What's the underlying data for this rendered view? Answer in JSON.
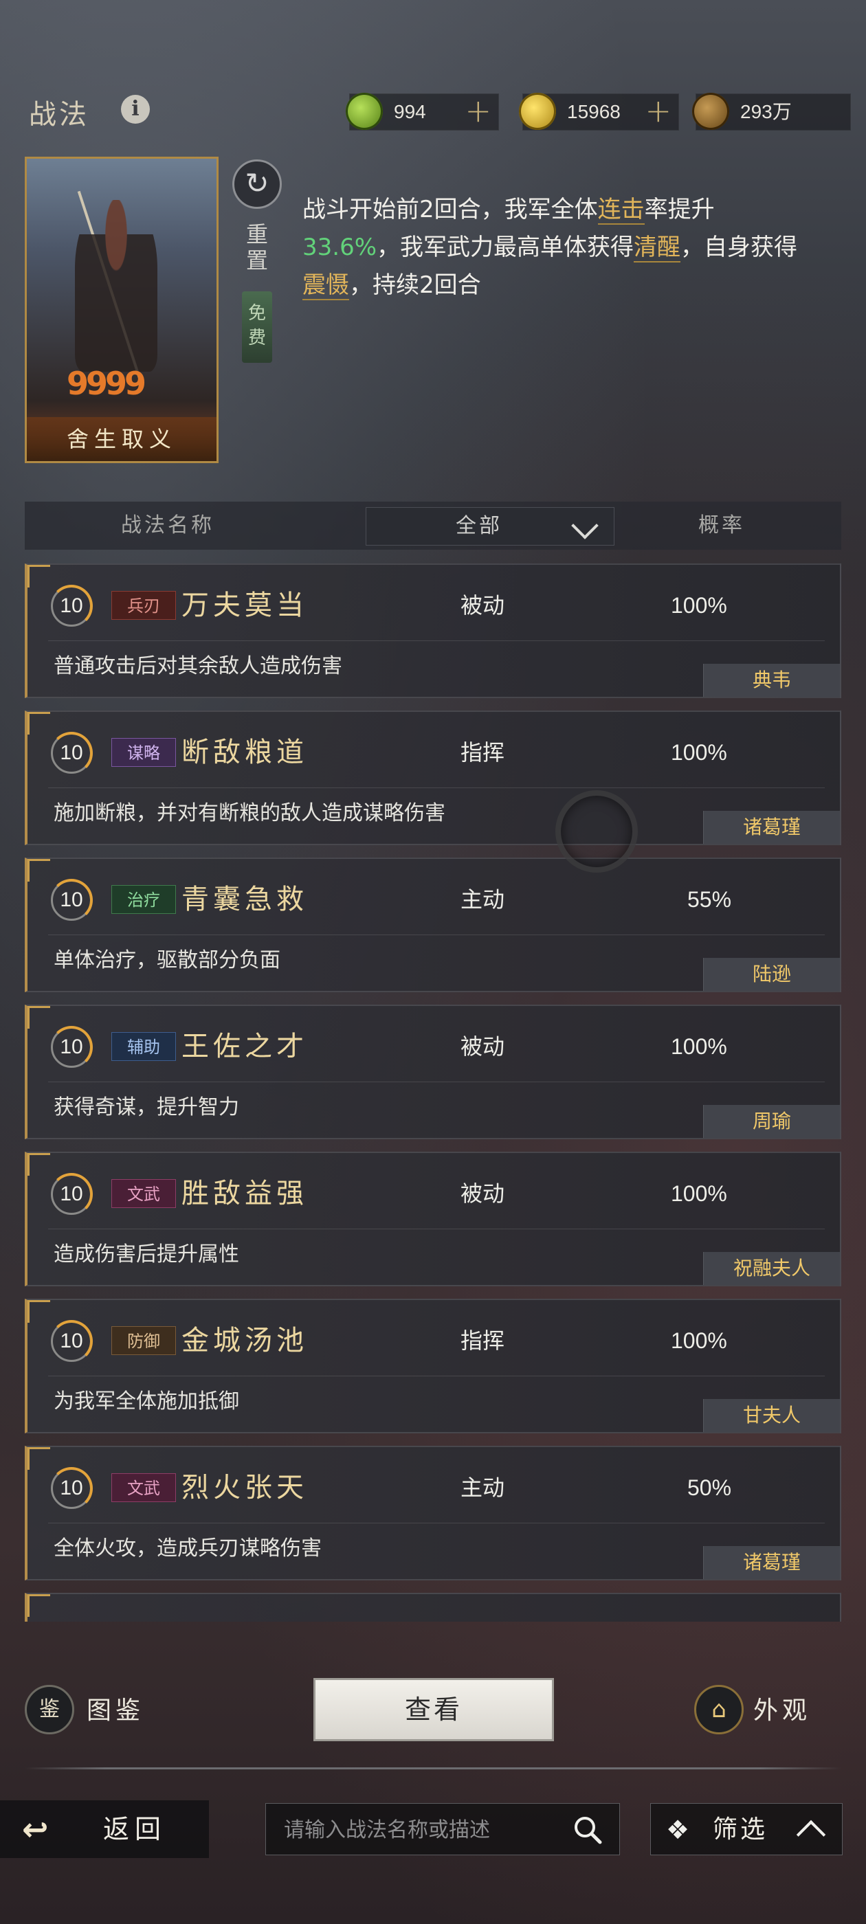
{
  "header": {
    "title": "战法",
    "info_icon": "i",
    "resources": [
      {
        "name": "jade-coin",
        "value": "994",
        "plus": "+",
        "color": "#7fae2a"
      },
      {
        "name": "gold-coin",
        "value": "15968",
        "plus": "+",
        "color": "#d6b21e"
      },
      {
        "name": "copper-coin",
        "value": "293万",
        "color": "#7a5a2a"
      }
    ]
  },
  "detail": {
    "card_name": "舍生取义",
    "card_flags": "9999",
    "reset_label": "重置",
    "reset_icon": "↻",
    "free_label": "免费",
    "description": {
      "p1": "战斗开始前2回合，我军全体",
      "kw1": "连击",
      "p2": "率提升",
      "num1": "33.6%",
      "p3": "，我军武力最高单体获得",
      "kw2": "清醒",
      "p4": "，自身获得",
      "kw3": "震慑",
      "p5": "，持续2回合"
    }
  },
  "table_header": {
    "name": "战法名称",
    "filter": "全部",
    "rate": "概率"
  },
  "skills": [
    {
      "level": "10",
      "tag": "兵刃",
      "tag_color": "red",
      "name": "万夫莫当",
      "type": "被动",
      "rate": "100%",
      "desc": "普通攻击后对其余敌人造成伤害",
      "owner": "典韦"
    },
    {
      "level": "10",
      "tag": "谋略",
      "tag_color": "purple",
      "name": "断敌粮道",
      "type": "指挥",
      "rate": "100%",
      "desc": "施加断粮，并对有断粮的敌人造成谋略伤害",
      "owner": "诸葛瑾"
    },
    {
      "level": "10",
      "tag": "治疗",
      "tag_color": "green",
      "name": "青囊急救",
      "type": "主动",
      "rate": "55%",
      "desc": "单体治疗，驱散部分负面",
      "owner": "陆逊"
    },
    {
      "level": "10",
      "tag": "辅助",
      "tag_color": "blue",
      "name": "王佐之才",
      "type": "被动",
      "rate": "100%",
      "desc": "获得奇谋，提升智力",
      "owner": "周瑜"
    },
    {
      "level": "10",
      "tag": "文武",
      "tag_color": "magenta",
      "name": "胜敌益强",
      "type": "被动",
      "rate": "100%",
      "desc": "造成伤害后提升属性",
      "owner": "祝融夫人"
    },
    {
      "level": "10",
      "tag": "防御",
      "tag_color": "brown",
      "name": "金城汤池",
      "type": "指挥",
      "rate": "100%",
      "desc": "为我军全体施加抵御",
      "owner": "甘夫人"
    },
    {
      "level": "10",
      "tag": "文武",
      "tag_color": "magenta",
      "name": "烈火张天",
      "type": "主动",
      "rate": "50%",
      "desc": "全体火攻，造成兵刃谋略伤害",
      "owner": "诸葛瑾"
    }
  ],
  "actions": {
    "codex_label": "图鉴",
    "codex_icon": "鉴",
    "view_label": "查看",
    "skin_label": "外观",
    "skin_icon": "⌂"
  },
  "bottom_bar": {
    "back_label": "返回",
    "back_icon": "↩",
    "search_placeholder": "请输入战法名称或描述",
    "filter_label": "筛选",
    "filter_icon": "❖"
  }
}
